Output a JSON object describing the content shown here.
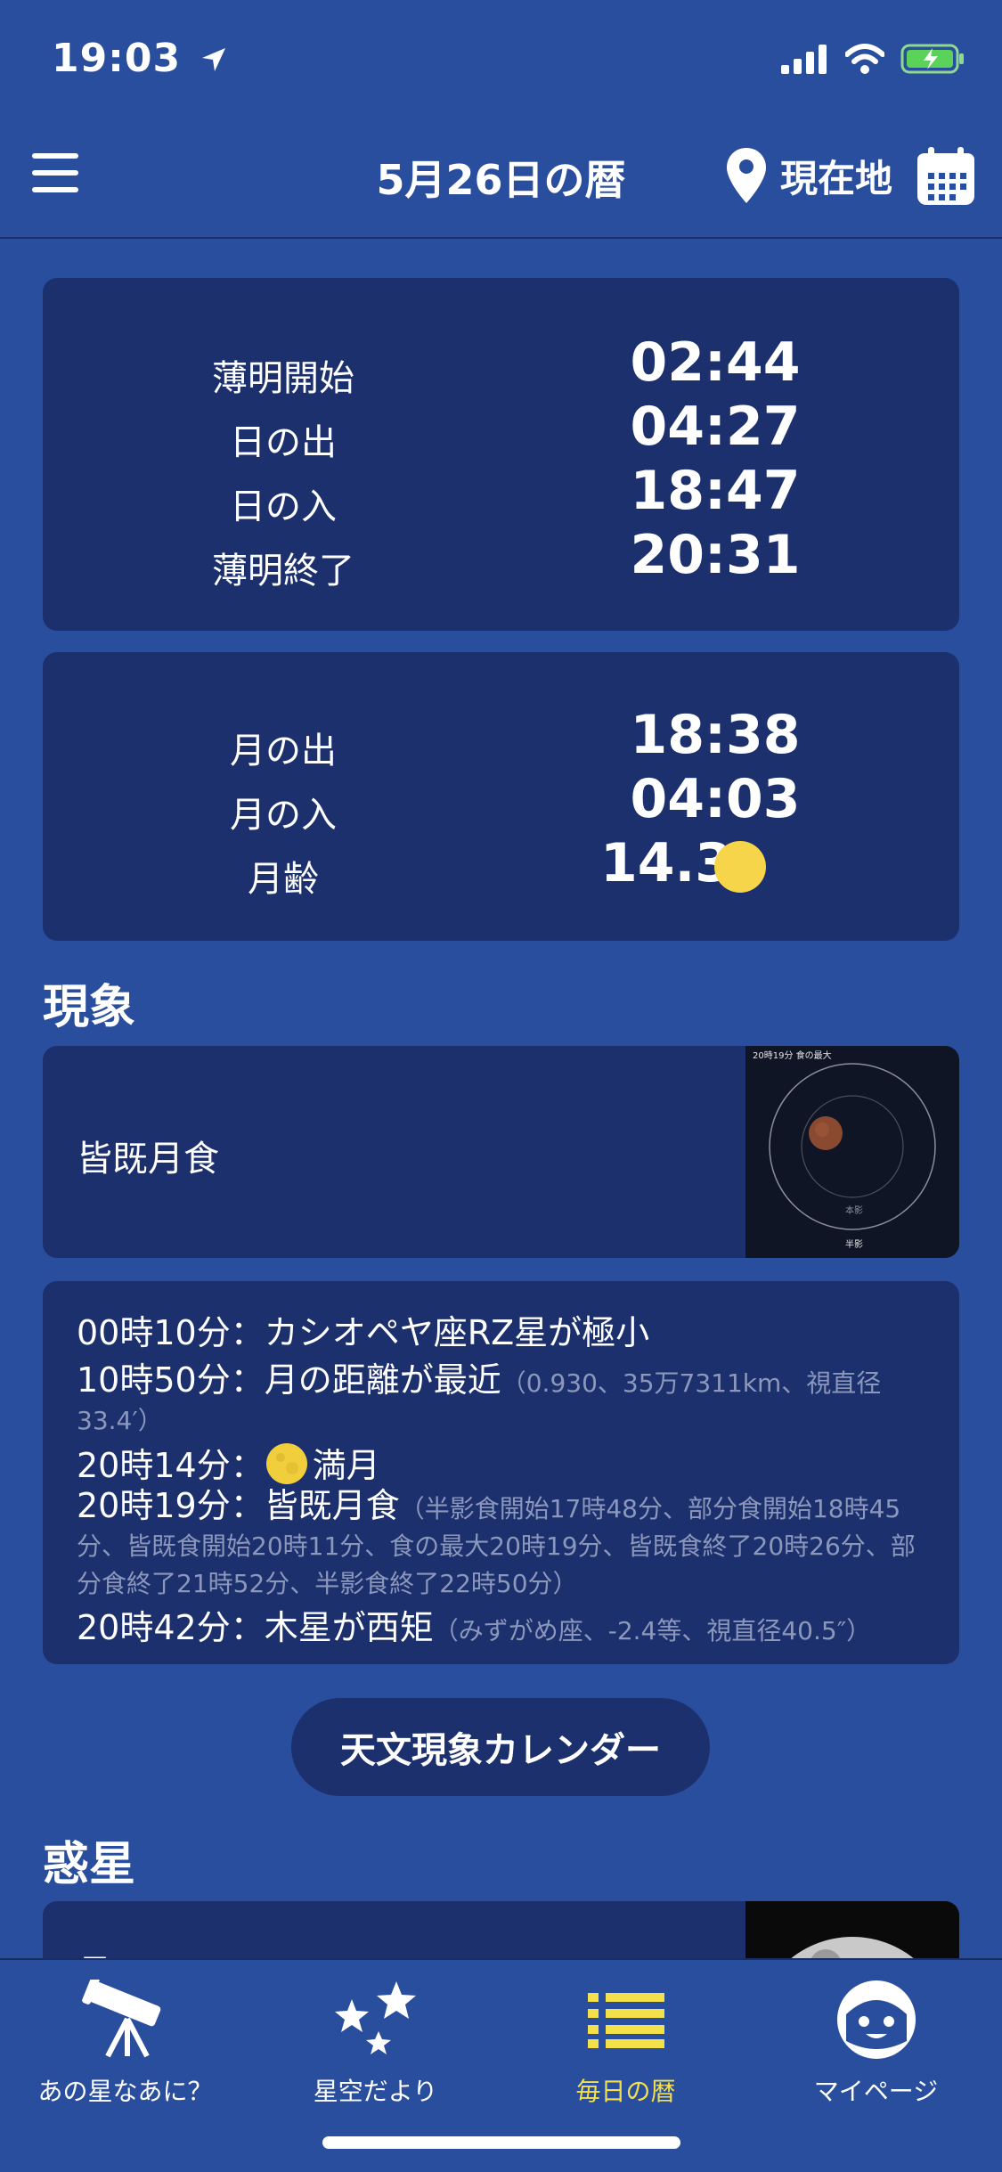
{
  "status": {
    "time": "19:03"
  },
  "header": {
    "title": "5月26日の暦",
    "location_label": "現在地"
  },
  "sun": [
    {
      "label": "薄明開始",
      "time": "02:44"
    },
    {
      "label": "日の出",
      "time": "04:27"
    },
    {
      "label": "日の入",
      "time": "18:47"
    },
    {
      "label": "薄明終了",
      "time": "20:31"
    }
  ],
  "moon": {
    "rise_label": "月の出",
    "rise_time": "18:38",
    "set_label": "月の入",
    "set_time": "04:03",
    "age_label": "月齢",
    "age_value": "14.3",
    "icon": "full-moon-icon"
  },
  "phenomena": {
    "title": "現象",
    "feature": {
      "name": "皆既月食",
      "thumb_caption": "20時19分 食の最大",
      "thumb_umbra": "本影",
      "thumb_penumbra": "半影"
    },
    "events": [
      {
        "time": "00時10分：",
        "text": "カシオペヤ座RZ星が極小",
        "note": ""
      },
      {
        "time": "10時50分：",
        "text": "月の距離が最近",
        "note": "（0.930、35万7311km、視直径33.4′）"
      },
      {
        "time": "20時14分：",
        "text": "満月",
        "note": ""
      },
      {
        "time": "20時19分：",
        "text": "皆既月食",
        "note": "（半影食開始17時48分、部分食開始18時45分、皆既食開始20時11分、食の最大20時19分、皆既食終了20時26分、部分食終了21時52分、半影食終了22時50分）"
      },
      {
        "time": "20時42分：",
        "text": "木星が西矩",
        "note": "（みずがめ座、-2.4等、視直径40.5″）"
      }
    ],
    "calendar_button": "天文現象カレンダー"
  },
  "planets": {
    "title": "惑星",
    "first_label": "月"
  },
  "tabs": [
    {
      "label": "あの星なあに？",
      "icon": "telescope-icon"
    },
    {
      "label": "星空だより",
      "icon": "stars-icon"
    },
    {
      "label": "毎日の暦",
      "icon": "list-icon",
      "active": true
    },
    {
      "label": "マイページ",
      "icon": "face-icon"
    }
  ],
  "colors": {
    "background": "#2a4e9e",
    "card": "#1c306e",
    "accent": "#f4e04b",
    "moon": "#f7d54a",
    "battery": "#5bd35b"
  }
}
